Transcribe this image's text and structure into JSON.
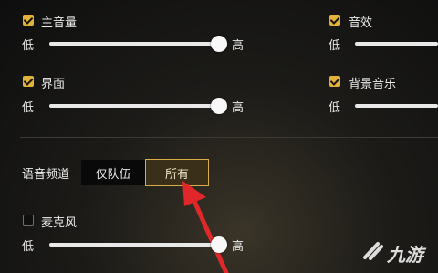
{
  "settings": {
    "main_volume": {
      "label": "主音量",
      "checked": true,
      "min_label": "低",
      "max_label": "高",
      "value": 0.95
    },
    "sfx": {
      "label": "音效",
      "checked": true,
      "min_label": "低",
      "max_label": "高"
    },
    "interface": {
      "label": "界面",
      "checked": true,
      "min_label": "低",
      "max_label": "高",
      "value": 0.95
    },
    "bgm": {
      "label": "背景音乐",
      "checked": true,
      "min_label": "低",
      "max_label": "高"
    },
    "voice_channel": {
      "label": "语音频道",
      "options": [
        "仅队伍",
        "所有"
      ],
      "selected": "所有"
    },
    "microphone": {
      "label": "麦克风",
      "checked": false,
      "min_label": "低",
      "max_label": "高",
      "value": 0.95
    }
  },
  "colors": {
    "accent": "#e2b33a",
    "arrow": "#e0282b",
    "selected_border": "#d8ad45"
  },
  "watermark": {
    "text": "九游"
  }
}
